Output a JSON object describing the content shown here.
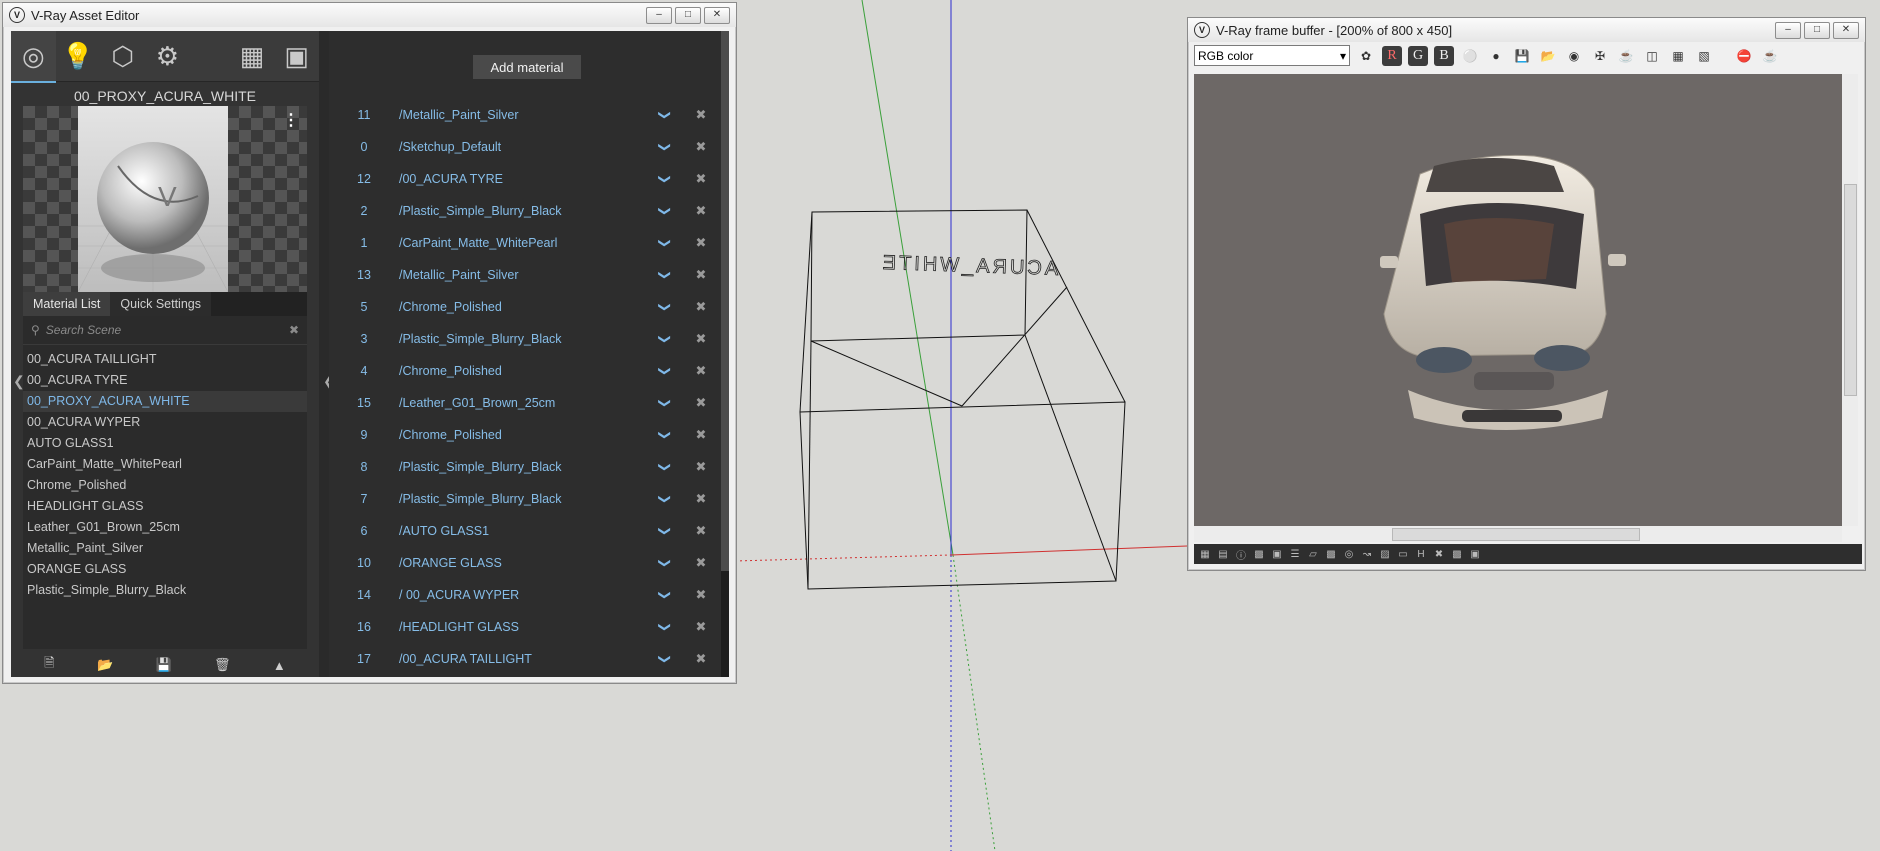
{
  "asset_editor": {
    "title": "V-Ray Asset Editor",
    "window_controls": [
      "–",
      "□",
      "✕"
    ],
    "current_material": "00_PROXY_ACURA_WHITE",
    "list_tabs": [
      "Material List",
      "Quick Settings"
    ],
    "search_placeholder": "Search Scene",
    "materials": [
      "00_ACURA TAILLIGHT",
      "00_ACURA TYRE",
      "00_PROXY_ACURA_WHITE",
      "00_ACURA WYPER",
      "AUTO GLASS1",
      "CarPaint_Matte_WhitePearl",
      "Chrome_Polished",
      "HEADLIGHT GLASS",
      "Leather_G01_Brown_25cm",
      "Metallic_Paint_Silver",
      "ORANGE GLASS",
      "Plastic_Simple_Blurry_Black"
    ],
    "selected_material_index": 2,
    "add_material_label": "Add material",
    "slots": [
      {
        "id": "11",
        "name": "/Metallic_Paint_Silver"
      },
      {
        "id": "0",
        "name": "/Sketchup_Default"
      },
      {
        "id": "12",
        "name": "/00_ACURA TYRE"
      },
      {
        "id": "2",
        "name": "/Plastic_Simple_Blurry_Black"
      },
      {
        "id": "1",
        "name": "/CarPaint_Matte_WhitePearl"
      },
      {
        "id": "13",
        "name": "/Metallic_Paint_Silver"
      },
      {
        "id": "5",
        "name": "/Chrome_Polished"
      },
      {
        "id": "3",
        "name": "/Plastic_Simple_Blurry_Black"
      },
      {
        "id": "4",
        "name": "/Chrome_Polished"
      },
      {
        "id": "15",
        "name": "/Leather_G01_Brown_25cm"
      },
      {
        "id": "9",
        "name": "/Chrome_Polished"
      },
      {
        "id": "8",
        "name": "/Plastic_Simple_Blurry_Black"
      },
      {
        "id": "7",
        "name": "/Plastic_Simple_Blurry_Black"
      },
      {
        "id": "6",
        "name": "/AUTO GLASS1"
      },
      {
        "id": "10",
        "name": "/ORANGE GLASS"
      },
      {
        "id": "14",
        "name": "/ 00_ACURA WYPER"
      },
      {
        "id": "16",
        "name": "/HEADLIGHT GLASS"
      },
      {
        "id": "17",
        "name": "/00_ACURA TAILLIGHT"
      }
    ],
    "colors": {
      "panel": "#333333",
      "accent": "#7fb8e8",
      "list_text": "#c9c9c9"
    }
  },
  "vfb": {
    "title": "V-Ray frame buffer - [200% of 800 x 450]",
    "channel": "RGB color",
    "channel_buttons": [
      "R",
      "G",
      "B"
    ],
    "window_controls": [
      "–",
      "□",
      "✕"
    ]
  },
  "viewport": {
    "model_text": "ACURA_WHITE",
    "axis_colors": {
      "green": "#3aa03a",
      "blue": "#2a2ad0",
      "red": "#d03030"
    }
  }
}
